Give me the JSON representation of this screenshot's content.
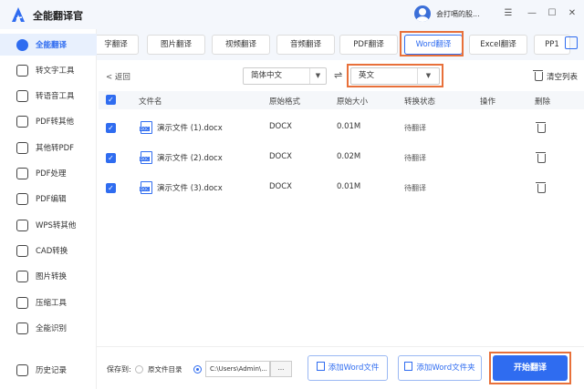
{
  "app": {
    "title": "全能翻译官",
    "username": "会打嗝的股...",
    "brand_color": "#2f6cf0",
    "highlight_color": "#e8703a"
  },
  "window_controls": [
    "☰",
    "—",
    "☐",
    "✕"
  ],
  "sidebar": {
    "items": [
      {
        "label": "全能翻译",
        "icon": "translate-icon",
        "active": true
      },
      {
        "label": "转文字工具",
        "icon": "text-icon"
      },
      {
        "label": "转语音工具",
        "icon": "voice-icon"
      },
      {
        "label": "PDF转其他",
        "icon": "pdf-icon"
      },
      {
        "label": "其他转PDF",
        "icon": "convert-icon"
      },
      {
        "label": "PDF处理",
        "icon": "pdf-process-icon"
      },
      {
        "label": "PDF编辑",
        "icon": "pdf-edit-icon"
      },
      {
        "label": "WPS转其他",
        "icon": "wps-icon"
      },
      {
        "label": "CAD转换",
        "icon": "cad-icon"
      },
      {
        "label": "图片转换",
        "icon": "image-icon"
      },
      {
        "label": "压缩工具",
        "icon": "compress-icon"
      },
      {
        "label": "全能识别",
        "icon": "recognize-icon"
      },
      {
        "label": "历史记录",
        "icon": "history-icon"
      }
    ]
  },
  "tabs": [
    {
      "label": "字翻译"
    },
    {
      "label": "图片翻译"
    },
    {
      "label": "视频翻译"
    },
    {
      "label": "音频翻译"
    },
    {
      "label": "PDF翻译"
    },
    {
      "label": "Word翻译",
      "active": true
    },
    {
      "label": "Excel翻译"
    },
    {
      "label": "PP1"
    }
  ],
  "toolbar": {
    "back": "< 返回",
    "source_lang": "简体中文",
    "target_lang": "英文",
    "clear_list": "清空列表"
  },
  "table": {
    "headers": [
      "文件名",
      "原始格式",
      "原始大小",
      "转换状态",
      "操作",
      "删除"
    ],
    "rows": [
      {
        "name": "演示文件 (1).docx",
        "format": "DOCX",
        "size": "0.01M",
        "status": "待翻译"
      },
      {
        "name": "演示文件 (2).docx",
        "format": "DOCX",
        "size": "0.02M",
        "status": "待翻译"
      },
      {
        "name": "演示文件 (3).docx",
        "format": "DOCX",
        "size": "0.01M",
        "status": "待翻译"
      }
    ]
  },
  "footer": {
    "save_to": "保存到:",
    "option_source": "原文件目录",
    "path": "C:\\Users\\Admin\\...",
    "browse": "...",
    "add_file": "添加Word文件",
    "add_folder": "添加Word文件夹",
    "start": "开始翻译"
  }
}
